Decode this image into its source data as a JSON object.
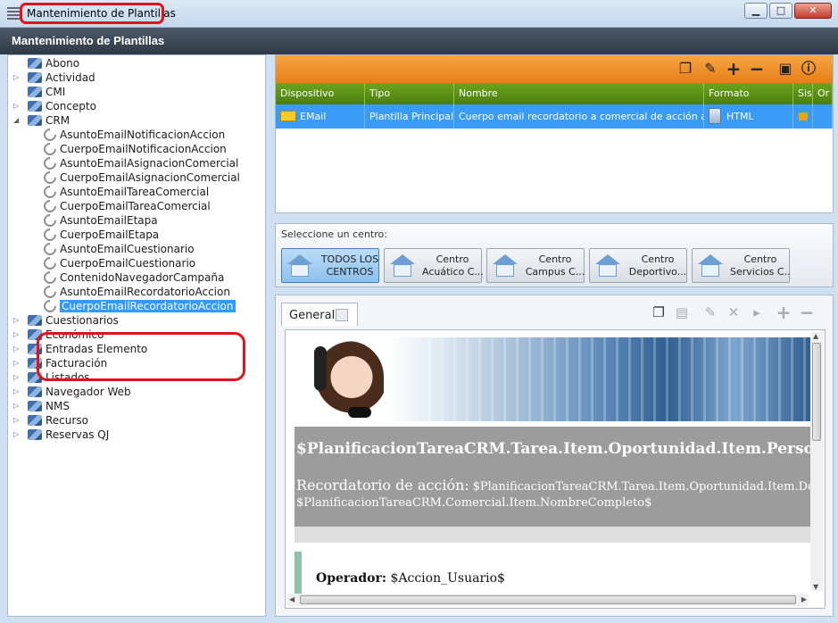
{
  "window": {
    "title": "Mantenimiento de Plantillas",
    "minimize": "▁",
    "maximize": "□",
    "close": "✕"
  },
  "header": {
    "title": "Mantenimiento de Plantillas"
  },
  "tree": {
    "items": [
      {
        "label": "Abono",
        "level": 0,
        "expander": ""
      },
      {
        "label": "Actividad",
        "level": 0,
        "expander": "▷"
      },
      {
        "label": "CMI",
        "level": 0,
        "expander": ""
      },
      {
        "label": "Concepto",
        "level": 0,
        "expander": "▷"
      },
      {
        "label": "CRM",
        "level": 0,
        "expander": "◢"
      },
      {
        "label": "AsuntoEmailNotificacionAccion",
        "level": 1
      },
      {
        "label": "CuerpoEmailNotificacionAccion",
        "level": 1
      },
      {
        "label": "AsuntoEmailAsignacionComercial",
        "level": 1
      },
      {
        "label": "CuerpoEmailAsignacionComercial",
        "level": 1
      },
      {
        "label": "AsuntoEmailTareaComercial",
        "level": 1
      },
      {
        "label": "CuerpoEmailTareaComercial",
        "level": 1
      },
      {
        "label": "AsuntoEmailEtapa",
        "level": 1
      },
      {
        "label": "CuerpoEmailEtapa",
        "level": 1
      },
      {
        "label": "AsuntoEmailCuestionario",
        "level": 1
      },
      {
        "label": "CuerpoEmailCuestionario",
        "level": 1
      },
      {
        "label": "ContenidoNavegadorCampaña",
        "level": 1
      },
      {
        "label": "AsuntoEmailRecordatorioAccion",
        "level": 1
      },
      {
        "label": "CuerpoEmailRecordatorioAccion",
        "level": 1,
        "selected": true
      },
      {
        "label": "Cuestionarios",
        "level": 0,
        "expander": "▷"
      },
      {
        "label": "Económico",
        "level": 0,
        "expander": "▷"
      },
      {
        "label": "Entradas Elemento",
        "level": 0,
        "expander": "▷"
      },
      {
        "label": "Facturación",
        "level": 0,
        "expander": "▷"
      },
      {
        "label": "Listados",
        "level": 0,
        "expander": "▷"
      },
      {
        "label": "Navegador Web",
        "level": 0,
        "expander": "▷"
      },
      {
        "label": "NMS",
        "level": 0,
        "expander": "▷"
      },
      {
        "label": "Recurso",
        "level": 0,
        "expander": "▷"
      },
      {
        "label": "Reservas QJ",
        "level": 0,
        "expander": "▷"
      }
    ]
  },
  "grid": {
    "toolbar": [
      "copy-icon",
      "pencil-icon",
      "plus-icon",
      "minus-icon",
      "image-icon",
      "info-icon"
    ],
    "columns": [
      "Dispositivo",
      "Tipo",
      "Nombre",
      "Formato",
      "Sis",
      "Or"
    ],
    "rows": [
      {
        "dispositivo": "EMail",
        "tipo": "Plantilla Principal",
        "nombre": "Cuerpo email recordatorio a comercial de acción a reali",
        "formato": "HTML"
      }
    ]
  },
  "centers": {
    "label": "Seleccione un centro:",
    "buttons": [
      {
        "line1": "TODOS LOS",
        "line2": "CENTROS",
        "active": true
      },
      {
        "line1": "Centro",
        "line2": "Acuático C..."
      },
      {
        "line1": "Centro",
        "line2": "Campus C..."
      },
      {
        "line1": "Centro",
        "line2": "Deportivo..."
      },
      {
        "line1": "Centro",
        "line2": "Servicios C..."
      }
    ]
  },
  "editor": {
    "tab": "General",
    "content": {
      "title": "$PlanificacionTareaCRM.Tarea.Item.Oportunidad.Item.Persona.Item.N",
      "reminder_label": "Recordatorio de acción:",
      "reminder_value": "$PlanificacionTareaCRM.Tarea.Item.Oportunidad.Item.Desc",
      "line2": "$PlanificacionTareaCRM.Comercial.Item.NombreCompleto$",
      "operator_label": "Operador:",
      "operator_value": "$Accion_Usuario$"
    }
  }
}
